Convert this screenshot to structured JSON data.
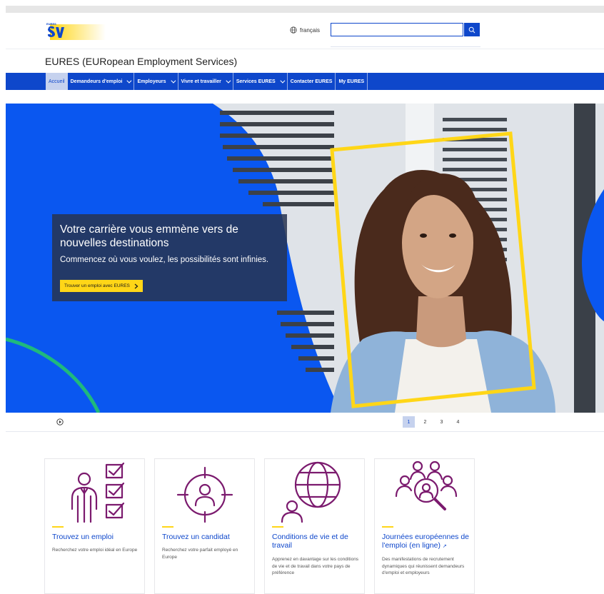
{
  "header": {
    "language": "français",
    "search_placeholder": "",
    "logo_text": "EURES"
  },
  "site": {
    "title": "EURES (EURopean Employment Services)"
  },
  "nav": {
    "items": [
      {
        "label": "Accueil",
        "active": true,
        "dropdown": false
      },
      {
        "label": "Demandeurs d'emploi",
        "active": false,
        "dropdown": true
      },
      {
        "label": "Employeurs",
        "active": false,
        "dropdown": true
      },
      {
        "label": "Vivre et travailler",
        "active": false,
        "dropdown": true
      },
      {
        "label": "Services EURES",
        "active": false,
        "dropdown": true
      },
      {
        "label": "Contacter EURES",
        "active": false,
        "dropdown": false
      },
      {
        "label": "My EURES",
        "active": false,
        "dropdown": false
      }
    ]
  },
  "hero": {
    "title": "Votre carrière vous emmène vers de nouvelles destinations",
    "subtitle": "Commencez où vous voulez, les possibilités sont infinies.",
    "cta": "Trouver un emploi avec EURES"
  },
  "carousel": {
    "pages": [
      "1",
      "2",
      "3",
      "4"
    ],
    "active_page": "1"
  },
  "cards": [
    {
      "title": "Trouvez un emploi",
      "desc": "Recherchez votre emploi idéal en Europe",
      "icon": "job-checklist-icon"
    },
    {
      "title": "Trouvez un candidat",
      "desc": "Recherchez votre parfait employé en Europe",
      "icon": "candidate-target-icon"
    },
    {
      "title": "Conditions de vie et de travail",
      "desc": "Apprenez en davantage sur les conditions de vie et de travail dans votre pays de préférence",
      "icon": "globe-person-icon"
    },
    {
      "title": "Journées européennes de l'emploi (en ligne)",
      "desc": "Des manifestations de recrutement dynamiques qui réunissent demandeurs d'emploi et employeurs",
      "icon": "group-search-icon"
    }
  ],
  "colors": {
    "primary": "#0e47cb",
    "accent": "#ffd617",
    "icon_purple": "#7b1a6e",
    "hero_blue": "#0a57f0"
  }
}
